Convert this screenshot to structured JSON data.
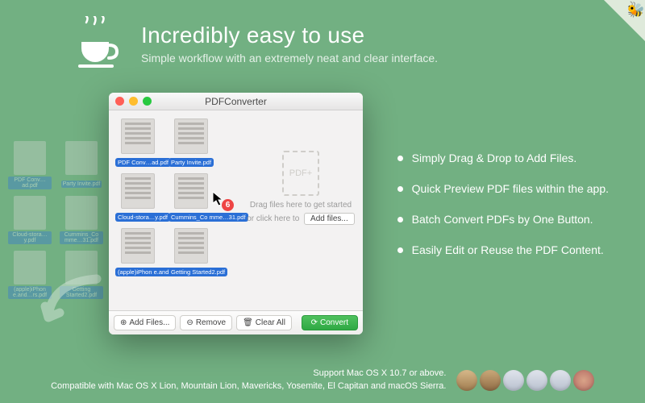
{
  "hero": {
    "title": "Incredibly easy to use",
    "subtitle": "Simple workflow with an extremely neat and clear interface."
  },
  "bullets": [
    "Simply Drag & Drop to Add Files.",
    "Quick Preview PDF files within the app.",
    "Batch Convert PDFs by One Button.",
    "Easily Edit or Reuse the PDF Content."
  ],
  "desktop_files": [
    "PDF Conv…ad.pdf",
    "Party Invite.pdf",
    "Cloud-stora…y.pdf",
    "Cummins_Co mme…31.pdf",
    "(apple)iPhon e.and…rs.pdf",
    "Getting Started2.pdf"
  ],
  "window": {
    "title": "PDFConverter",
    "files": [
      "PDF Conv…ad.pdf",
      "Party Invite.pdf",
      "Cloud-stora…y.pdf",
      "Cummins_Co mme…31.pdf",
      "(apple)iPhon e.and…rs.pdf",
      "Getting Started2.pdf"
    ],
    "drag_badge": "6",
    "dropzone": {
      "placeholder_icon": "PDF+",
      "line1": "Drag files here to get started",
      "line2_prefix": "or click here to",
      "add_button": "Add files..."
    },
    "toolbar": {
      "add": "Add Files...",
      "remove": "Remove",
      "clear": "Clear All",
      "convert": "Convert"
    }
  },
  "footer": {
    "line1": "Support Mac OS X 10.7 or above.",
    "line2": "Compatible with Mac OS X Lion, Mountain Lion, Mavericks, Yosemite, El Capitan and macOS Sierra."
  }
}
